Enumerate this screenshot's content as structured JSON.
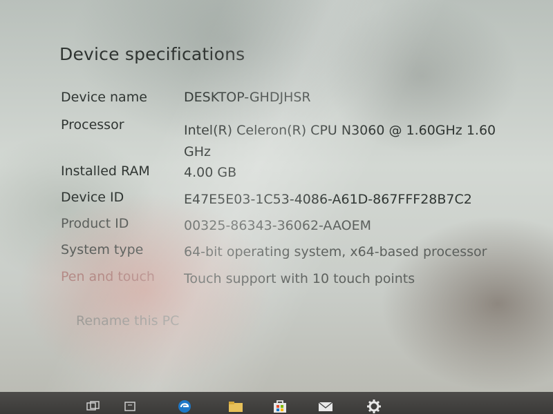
{
  "window": {
    "heading": "Device specifications"
  },
  "specs": [
    {
      "label": "Device name",
      "value": "DESKTOP-GHDJHSR"
    },
    {
      "label": "Processor",
      "value": "Intel(R) Celeron(R) CPU  N3060  @ 1.60GHz   1.60 GHz"
    },
    {
      "label": "Installed RAM",
      "value": "4.00 GB"
    },
    {
      "label": "Device ID",
      "value": "E47E5E03-1C53-4086-A61D-867FFF28B7C2"
    },
    {
      "label": "Product ID",
      "value": "00325-86343-36062-AAOEM"
    },
    {
      "label": "System type",
      "value": "64-bit operating system, x64-based processor"
    },
    {
      "label": "Pen and touch",
      "value": "Touch support with 10 touch points"
    }
  ],
  "actions": {
    "rename_label": "Rename this PC"
  },
  "taskbar": {
    "icons": [
      "task-view-icon",
      "edge-browser-icon",
      "file-explorer-icon",
      "store-icon",
      "mail-icon",
      "settings-gear-icon"
    ]
  }
}
